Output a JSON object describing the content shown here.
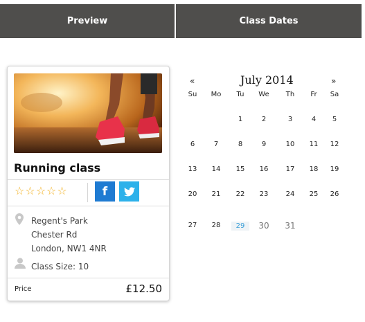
{
  "tabs": [
    {
      "label": "Preview"
    },
    {
      "label": "Class Dates"
    }
  ],
  "card": {
    "title": "Running class",
    "rating": 0,
    "rating_max": 5,
    "address": [
      "Regent's Park",
      "Chester Rd",
      "London, NW1 4NR"
    ],
    "class_size": "Class Size: 10",
    "price_label": "Price",
    "price": "£12.50",
    "facebook_label": "f"
  },
  "calendar": {
    "prev": "«",
    "next": "»",
    "month_title": "July 2014",
    "weekdays": [
      "Su",
      "Mo",
      "Tu",
      "We",
      "Th",
      "Fr",
      "Sa"
    ],
    "weeks": [
      [
        "",
        "",
        "1",
        "2",
        "3",
        "4",
        "5"
      ],
      [
        "6",
        "7",
        "8",
        "9",
        "10",
        "11",
        "12"
      ],
      [
        "13",
        "14",
        "15",
        "16",
        "17",
        "18",
        "19"
      ],
      [
        "20",
        "21",
        "22",
        "23",
        "24",
        "25",
        "26"
      ],
      [
        "27",
        "28",
        "29",
        "30",
        "31",
        "",
        ""
      ]
    ],
    "highlighted_day": "29",
    "muted_days": [
      "30",
      "31"
    ]
  },
  "colors": {
    "tab_bg": "#4f4e4c",
    "star": "#f2b01e",
    "facebook": "#1f7bd2",
    "twitter": "#2db1ea",
    "highlight_text": "#3a9fd8"
  },
  "icons": [
    "star-icon",
    "facebook-icon",
    "twitter-icon",
    "location-pin-icon",
    "person-icon"
  ]
}
